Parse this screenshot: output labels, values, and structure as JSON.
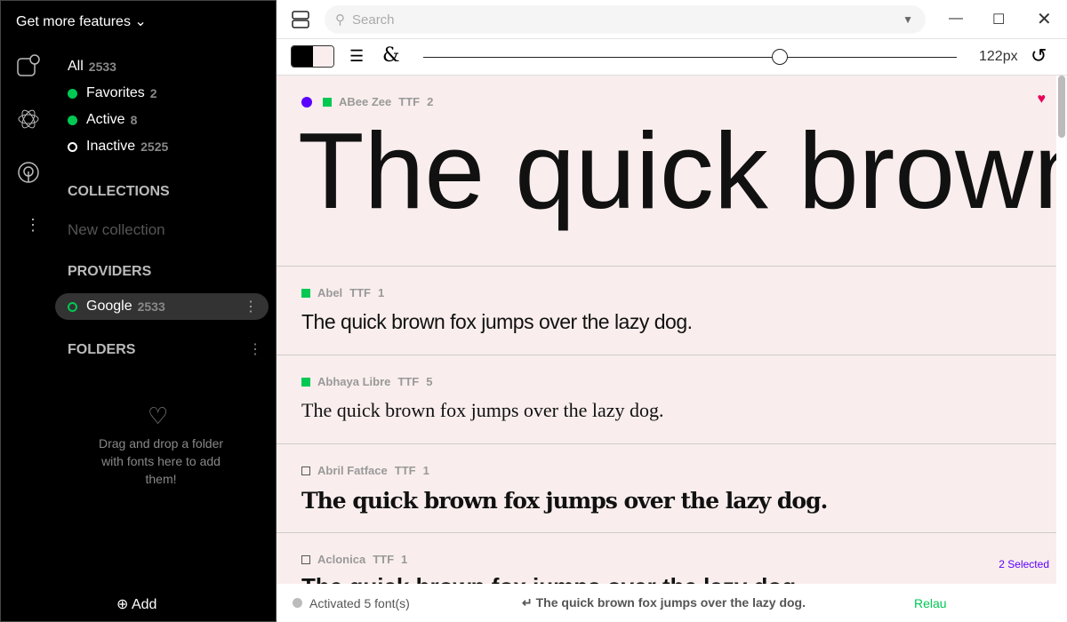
{
  "sidebar": {
    "features": "Get more features",
    "all": {
      "label": "All",
      "count": "2533"
    },
    "favorites": {
      "label": "Favorites",
      "count": "2"
    },
    "active": {
      "label": "Active",
      "count": "8"
    },
    "inactive": {
      "label": "Inactive",
      "count": "2525"
    },
    "collections": "COLLECTIONS",
    "new_collection": "New collection",
    "providers": "PROVIDERS",
    "google": {
      "label": "Google",
      "count": "2533"
    },
    "folders": "FOLDERS",
    "drop_text": "Drag and drop a folder with fonts here to add them!",
    "add": "Add"
  },
  "search": {
    "placeholder": "Search"
  },
  "toolbar": {
    "size": "122px",
    "size_value": 122
  },
  "sample_text": "The quick brown fox jumps over the lazy dog.",
  "hero_text": "The quick brown",
  "fonts": [
    {
      "name": "ABee Zee",
      "format": "TTF",
      "count": "2",
      "favorite": true,
      "active": true
    },
    {
      "name": "Abel",
      "format": "TTF",
      "count": "1",
      "active": true
    },
    {
      "name": "Abhaya Libre",
      "format": "TTF",
      "count": "5",
      "active": true
    },
    {
      "name": "Abril Fatface",
      "format": "TTF",
      "count": "1",
      "active": false
    },
    {
      "name": "Aclonica",
      "format": "TTF",
      "count": "1",
      "active": false
    }
  ],
  "selected": "2 Selected",
  "status": {
    "activated": "Activated 5 font(s)",
    "preview": "↵ The quick brown fox jumps over the lazy dog.",
    "relaunch": "Relau"
  },
  "colors": {
    "active": "#00c853",
    "accent": "#5b00ff",
    "heart": "#e8005a"
  }
}
